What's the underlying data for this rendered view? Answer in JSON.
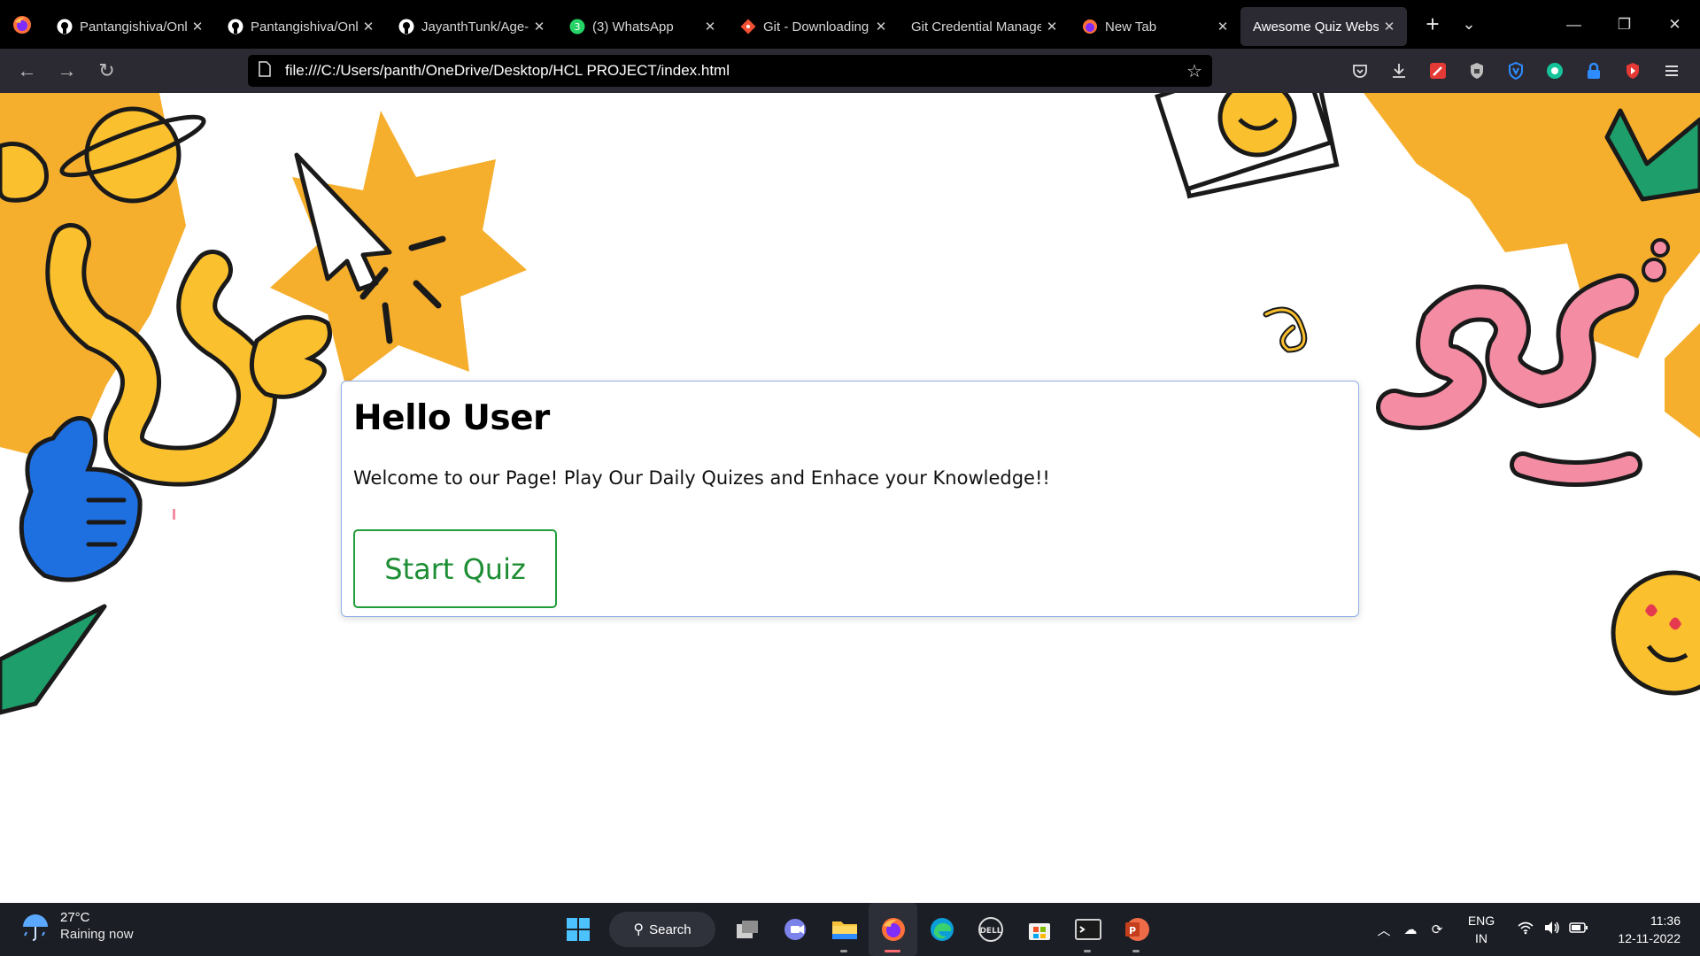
{
  "browser": {
    "tabs": [
      {
        "title": "Pantangishiva/Onl",
        "icon": "github-icon",
        "active": false
      },
      {
        "title": "Pantangishiva/Onl",
        "icon": "github-icon",
        "active": false
      },
      {
        "title": "JayanthTunk/Age-",
        "icon": "github-icon",
        "active": false
      },
      {
        "title": "(3) WhatsApp",
        "icon": "whatsapp-icon",
        "active": false
      },
      {
        "title": "Git - Downloading",
        "icon": "git-icon",
        "active": false
      },
      {
        "title": "Git Credential Manage",
        "icon": "none",
        "active": false
      },
      {
        "title": "New Tab",
        "icon": "firefox-icon",
        "active": false
      },
      {
        "title": "Awesome Quiz Websit",
        "icon": "none",
        "active": true
      }
    ],
    "whatsapp_badge": "3",
    "new_tab": "+",
    "url": "file:///C:/Users/panth/OneDrive/Desktop/HCL PROJECT/index.html"
  },
  "page": {
    "heading": "Hello User",
    "welcome_text": "Welcome to our Page! Play Our Daily Quizes and Enhace your Knowledge!!",
    "start_button": "Start Quiz"
  },
  "taskbar": {
    "weather_temp": "27°C",
    "weather_desc": "Raining now",
    "search_label": "Search",
    "lang_line1": "ENG",
    "lang_line2": "IN",
    "time": "11:36",
    "date": "12-11-2022"
  },
  "colors": {
    "accent_green": "#1e9e3a",
    "card_border": "#8fb0e6",
    "doodle_orange": "#f6ae2d",
    "doodle_yellow": "#fbc02d",
    "doodle_pink": "#f48ca3",
    "doodle_blue": "#1e6fe0",
    "doodle_green": "#1e9e6a"
  }
}
